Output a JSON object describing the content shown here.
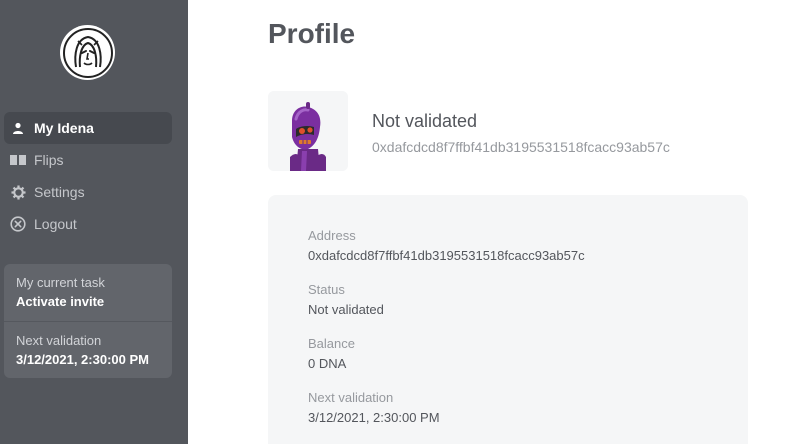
{
  "sidebar": {
    "logo_icon": "idena-logo-icon",
    "nav": [
      {
        "label": "My Idena",
        "icon": "user-icon",
        "active": true
      },
      {
        "label": "Flips",
        "icon": "flips-icon",
        "active": false
      },
      {
        "label": "Settings",
        "icon": "gear-icon",
        "active": false
      },
      {
        "label": "Logout",
        "icon": "close-circle-icon",
        "active": false
      }
    ],
    "task": {
      "current_label": "My current task",
      "current_value": "Activate invite",
      "next_label": "Next validation",
      "next_value": "3/12/2021, 2:30:00 PM"
    }
  },
  "main": {
    "title": "Profile",
    "user": {
      "state": "Not validated",
      "address": "0xdafcdcd8f7ffbf41db3195531518fcacc93ab57c"
    },
    "details": [
      {
        "label": "Address",
        "value": "0xdafcdcd8f7ffbf41db3195531518fcacc93ab57c"
      },
      {
        "label": "Status",
        "value": "Not validated"
      },
      {
        "label": "Balance",
        "value": "0 DNA"
      },
      {
        "label": "Next validation",
        "value": "3/12/2021, 2:30:00 PM"
      }
    ]
  },
  "colors": {
    "sidebar_bg": "#53565c",
    "sidebar_active": "#46494f",
    "card_bg": "#f5f6f7",
    "text": "#53565c",
    "muted": "#96999e"
  }
}
